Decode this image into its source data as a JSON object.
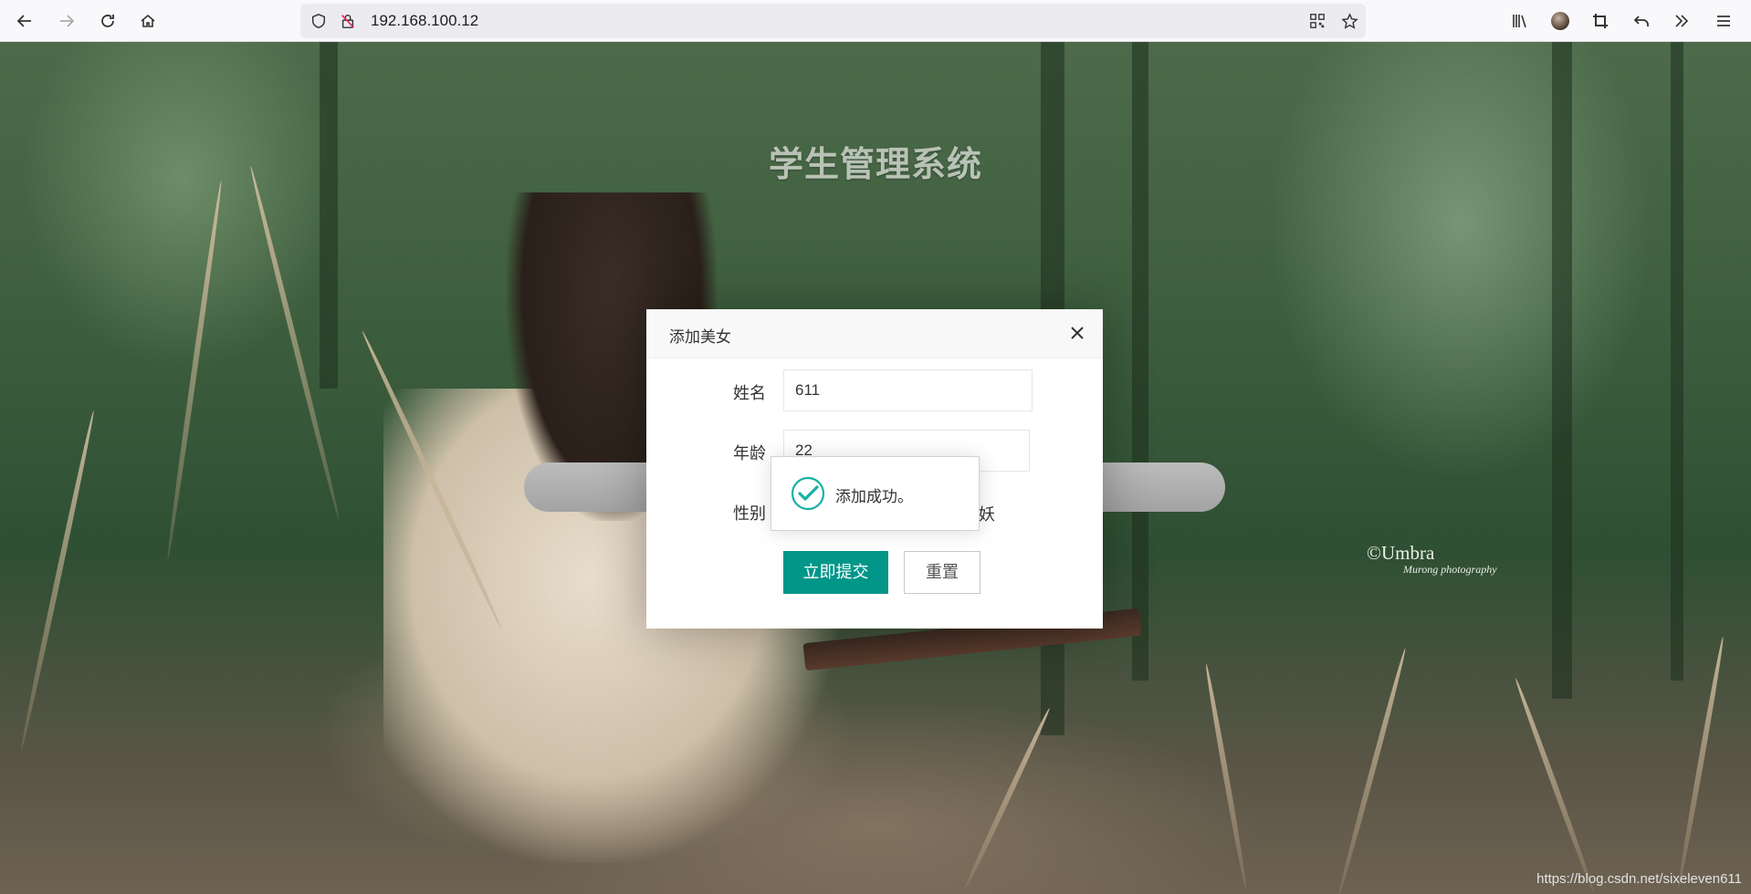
{
  "browser": {
    "url": "192.168.100.12"
  },
  "page": {
    "title": "学生管理系统",
    "watermark_line1": "©Umbra",
    "watermark_line2": "Murong photography",
    "footer_url": "https://blog.csdn.net/sixeleven611"
  },
  "dialog": {
    "title": "添加美女",
    "fields": {
      "name_label": "姓名",
      "name_value": "611",
      "age_label": "年龄",
      "age_value": "22",
      "sex_label": "性别",
      "sex_partial": "妖"
    },
    "submit_label": "立即提交",
    "reset_label": "重置"
  },
  "toast": {
    "message": "添加成功。"
  },
  "colors": {
    "primary": "#009688",
    "toast_icon": "#16b2a4"
  }
}
